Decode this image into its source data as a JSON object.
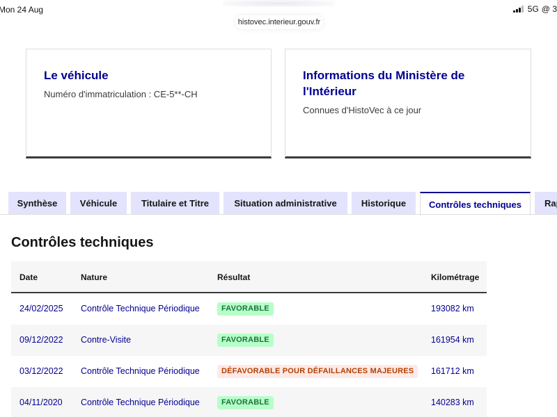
{
  "status_bar": {
    "date": "Mon 24 Aug",
    "network": "5G",
    "partial_right": "@ 3"
  },
  "browser": {
    "url": "histovec.interieur.gouv.fr"
  },
  "cards": [
    {
      "title": "Le véhicule",
      "text": "Numéro d'immatriculation : CE-5**-CH"
    },
    {
      "title": "Informations du Ministère de l'Intérieur",
      "text": "Connues d'HistoVec à ce jour"
    }
  ],
  "tabs": [
    {
      "label": "Synthèse",
      "active": false
    },
    {
      "label": "Véhicule",
      "active": false
    },
    {
      "label": "Titulaire et Titre",
      "active": false
    },
    {
      "label": "Situation administrative",
      "active": false
    },
    {
      "label": "Historique",
      "active": false
    },
    {
      "label": "Contrôles techniques",
      "active": true
    },
    {
      "label": "Rap",
      "active": false
    }
  ],
  "section_title": "Contrôles techniques",
  "table": {
    "headers": [
      "Date",
      "Nature",
      "Résultat",
      "Kilométrage"
    ],
    "rows": [
      {
        "date": "24/02/2025",
        "nature": "Contrôle Technique Périodique",
        "result": "FAVORABLE",
        "status": "ok",
        "km": "193082 km"
      },
      {
        "date": "09/12/2022",
        "nature": "Contre-Visite",
        "result": "FAVORABLE",
        "status": "ok",
        "km": "161954 km"
      },
      {
        "date": "03/12/2022",
        "nature": "Contrôle Technique Périodique",
        "result": "DÉFAVORABLE POUR DÉFAILLANCES MAJEURES",
        "status": "ko",
        "km": "161712 km"
      },
      {
        "date": "04/11/2020",
        "nature": "Contrôle Technique Périodique",
        "result": "FAVORABLE",
        "status": "ok",
        "km": "140283 km"
      }
    ]
  },
  "colors": {
    "brand_blue": "#000091",
    "tab_bg": "#e3e3fd",
    "success_bg": "#b8fec9",
    "success_text": "#18753c",
    "error_bg": "#ffe9e6",
    "error_text": "#b34000"
  }
}
